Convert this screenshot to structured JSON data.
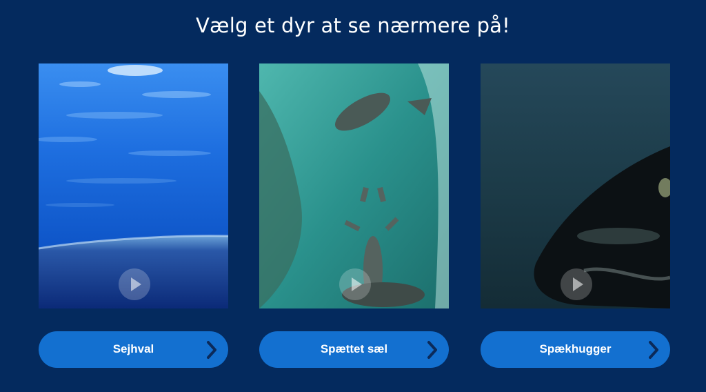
{
  "page": {
    "title": "Vælg et dyr at se nærmere på!",
    "background": "#042a5e"
  },
  "cards": [
    {
      "label": "Sejhval",
      "image": "fin-whale-underwater-video",
      "icon": "play-icon",
      "action_icon": "chevron-right-icon"
    },
    {
      "label": "Spættet sæl",
      "image": "harbour-seals-underwater-video",
      "icon": "play-icon",
      "action_icon": "chevron-right-icon"
    },
    {
      "label": "Spækhugger",
      "image": "orca-underwater-video",
      "icon": "play-icon",
      "action_icon": "chevron-right-icon"
    }
  ],
  "colors": {
    "button": "#1370d0",
    "button_text": "#ffffff",
    "chevron": "#0b2a5a"
  }
}
